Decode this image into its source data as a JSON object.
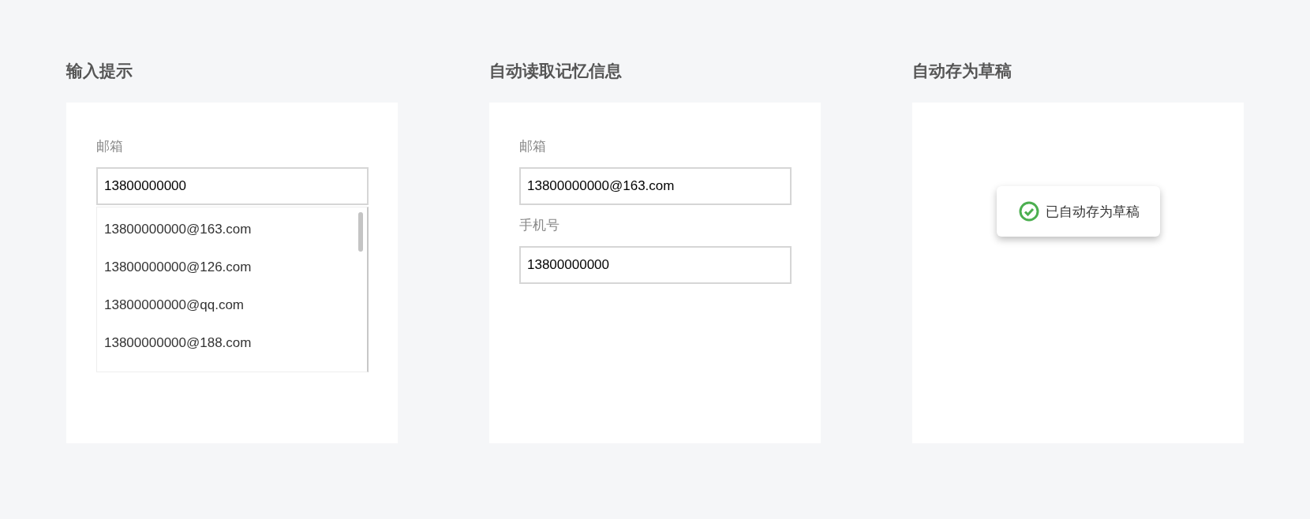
{
  "panels": [
    {
      "kind": "autocomplete",
      "title": "输入提示",
      "fields": [
        {
          "label": "邮箱",
          "value": "13800000000"
        }
      ],
      "suggestions": [
        "13800000000@163.com",
        "13800000000@126.com",
        "13800000000@qq.com",
        "13800000000@188.com"
      ]
    },
    {
      "kind": "form",
      "title": "自动读取记忆信息",
      "fields": [
        {
          "label": "邮箱",
          "value": "13800000000@163.com"
        },
        {
          "label": "手机号",
          "value": "13800000000"
        }
      ]
    },
    {
      "kind": "toast",
      "title": "自动存为草稿",
      "message": "已自动存为草稿"
    }
  ]
}
